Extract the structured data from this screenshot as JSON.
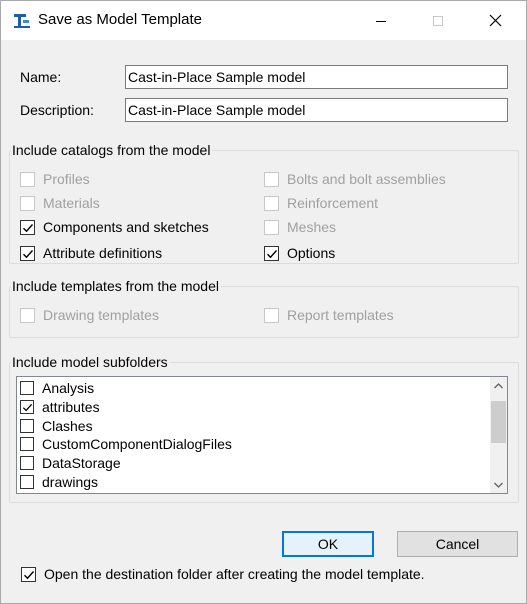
{
  "window": {
    "title": "Save as Model Template",
    "app_icon": "tekla-app-icon",
    "controls": [
      "minimize-icon",
      "maximize-icon",
      "close-icon"
    ]
  },
  "fields": {
    "name_label": "Name:",
    "name_value": "Cast-in-Place Sample model",
    "description_label": "Description:",
    "description_value": "Cast-in-Place Sample model"
  },
  "catalogs": {
    "title": "Include catalogs from the model",
    "items": [
      {
        "label": "Profiles",
        "checked": false,
        "enabled": false
      },
      {
        "label": "Bolts and bolt assemblies",
        "checked": false,
        "enabled": false
      },
      {
        "label": "Materials",
        "checked": false,
        "enabled": false
      },
      {
        "label": "Reinforcement",
        "checked": false,
        "enabled": false
      },
      {
        "label": "Components and sketches",
        "checked": true,
        "enabled": true
      },
      {
        "label": "Meshes",
        "checked": false,
        "enabled": false
      },
      {
        "label": "Attribute definitions",
        "checked": true,
        "enabled": true
      },
      {
        "label": "Options",
        "checked": true,
        "enabled": true
      }
    ]
  },
  "templates": {
    "title": "Include templates from the model",
    "items": [
      {
        "label": "Drawing templates",
        "checked": false,
        "enabled": false
      },
      {
        "label": "Report templates",
        "checked": false,
        "enabled": false
      }
    ]
  },
  "subfolders": {
    "title": "Include model subfolders",
    "items": [
      {
        "label": "Analysis",
        "checked": false
      },
      {
        "label": "attributes",
        "checked": true
      },
      {
        "label": "Clashes",
        "checked": false
      },
      {
        "label": "CustomComponentDialogFiles",
        "checked": false
      },
      {
        "label": "DataStorage",
        "checked": false
      },
      {
        "label": "drawings",
        "checked": false
      }
    ]
  },
  "buttons": {
    "ok": "OK",
    "cancel": "Cancel"
  },
  "open_folder": {
    "label": "Open the destination folder after creating the model template.",
    "checked": true
  }
}
